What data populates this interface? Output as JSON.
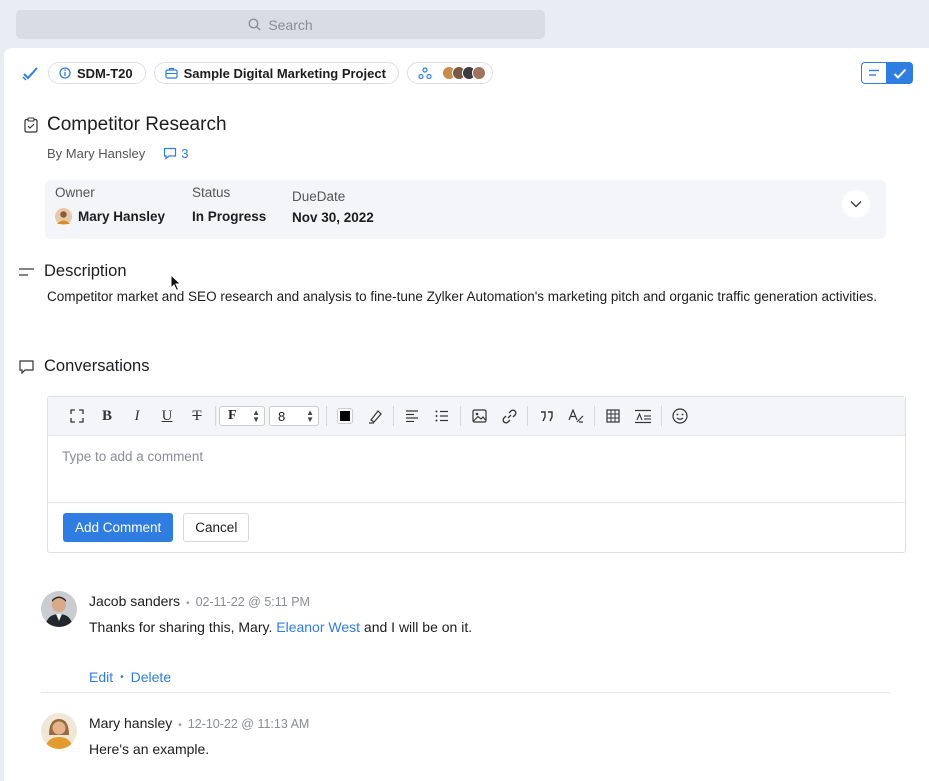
{
  "search": {
    "placeholder": "Search"
  },
  "topbar": {
    "task_id": "SDM-T20",
    "project": "Sample Digital Marketing Project"
  },
  "task": {
    "title": "Competitor Research",
    "byline": "By Mary Hansley",
    "comment_count": "3"
  },
  "meta": {
    "owner_label": "Owner",
    "owner_value": "Mary Hansley",
    "status_label": "Status",
    "status_value": "In Progress",
    "due_label": "DueDate",
    "due_value": "Nov 30, 2022"
  },
  "description": {
    "heading": "Description",
    "text": "Competitor market and SEO research and analysis to fine-tune Zylker Automation's marketing pitch and organic traffic generation activities."
  },
  "conversations": {
    "heading": "Conversations",
    "font_value": "F",
    "size_value": "8",
    "placeholder": "Type to add a comment",
    "add_label": "Add Comment",
    "cancel_label": "Cancel"
  },
  "comments": [
    {
      "author": "Jacob sanders",
      "time": "02-11-22 @ 5:11 PM",
      "text_before": "Thanks for sharing this, Mary. ",
      "mention": "Eleanor West",
      "text_after": " and I will be on it.",
      "edit_label": "Edit",
      "delete_label": "Delete"
    },
    {
      "author": "Mary hansley",
      "time": "12-10-22 @ 11:13 AM",
      "text": "Here's an example."
    }
  ],
  "colors": {
    "accent": "#2f7de1",
    "panel": "#ffffff",
    "backdrop": "#e9ecf5"
  }
}
